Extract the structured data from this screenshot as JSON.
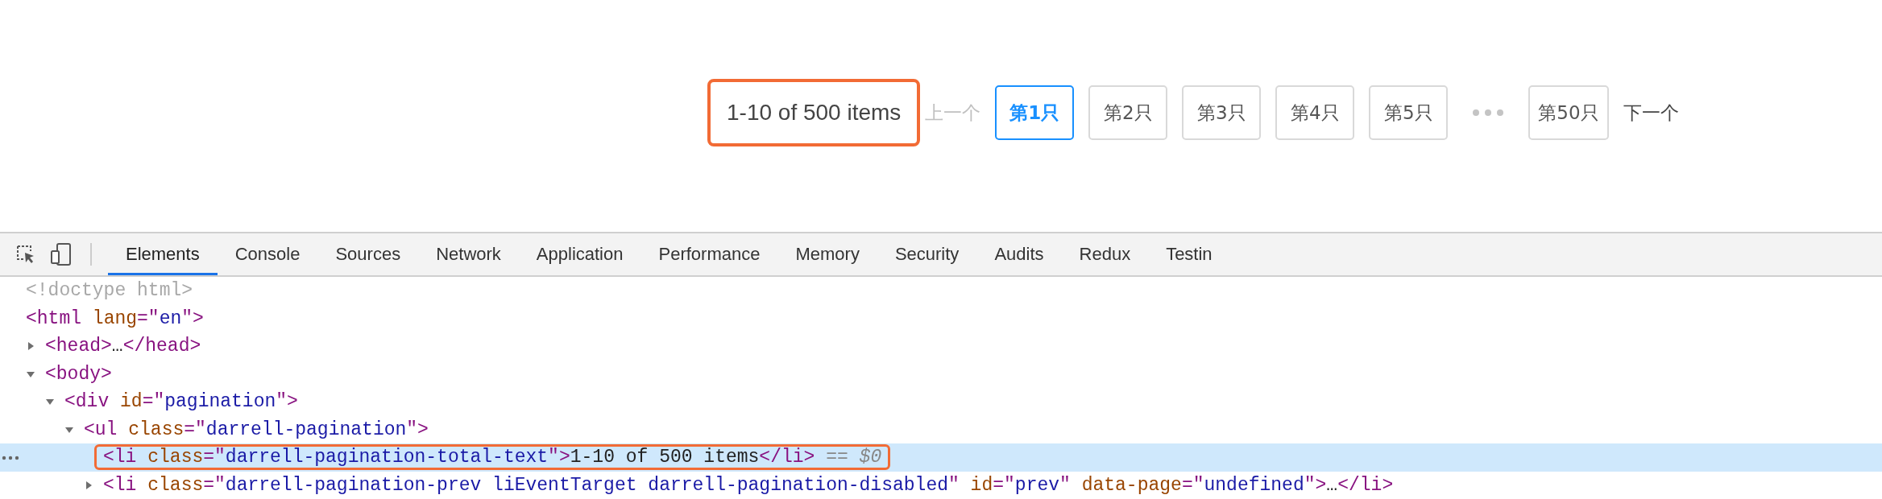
{
  "pagination": {
    "total_text": "1-10 of 500 items",
    "total_annotated": true,
    "items": [
      {
        "kind": "prev",
        "label": "上一个",
        "disabled": true
      },
      {
        "kind": "page",
        "label": "第1只",
        "selected": true
      },
      {
        "kind": "page",
        "label": "第2只",
        "selected": false
      },
      {
        "kind": "page",
        "label": "第3只",
        "selected": false
      },
      {
        "kind": "page",
        "label": "第4只",
        "selected": false
      },
      {
        "kind": "page",
        "label": "第5只",
        "selected": false
      },
      {
        "kind": "ellipsis"
      },
      {
        "kind": "page",
        "label": "第50只",
        "selected": false
      },
      {
        "kind": "next",
        "label": "下一个",
        "disabled": false
      }
    ]
  },
  "devtools": {
    "tabs": [
      {
        "label": "Elements",
        "selected": true
      },
      {
        "label": "Console",
        "selected": false
      },
      {
        "label": "Sources",
        "selected": false
      },
      {
        "label": "Network",
        "selected": false
      },
      {
        "label": "Application",
        "selected": false
      },
      {
        "label": "Performance",
        "selected": false
      },
      {
        "label": "Memory",
        "selected": false
      },
      {
        "label": "Security",
        "selected": false
      },
      {
        "label": "Audits",
        "selected": false
      },
      {
        "label": "Redux",
        "selected": false
      },
      {
        "label": "Testin",
        "selected": false
      }
    ],
    "dom_tree": [
      {
        "tokens": [
          {
            "kind": "doctype",
            "text": "<!doctype html>"
          }
        ]
      },
      {
        "tokens": [
          {
            "kind": "punct",
            "text": "<"
          },
          {
            "kind": "tag",
            "text": "html"
          },
          {
            "kind": "attr",
            "text": "lang"
          },
          {
            "kind": "punct",
            "text": "=\""
          },
          {
            "kind": "value",
            "text": "en"
          },
          {
            "kind": "punct",
            "text": "\">"
          }
        ],
        "children": [
          {
            "expanded": false,
            "tokens": [
              {
                "kind": "punct",
                "text": "<"
              },
              {
                "kind": "tag",
                "text": "head"
              },
              {
                "kind": "punct",
                "text": ">"
              },
              {
                "kind": "text",
                "text": "…"
              },
              {
                "kind": "punct",
                "text": "</"
              },
              {
                "kind": "tag",
                "text": "head"
              },
              {
                "kind": "punct",
                "text": ">"
              }
            ]
          },
          {
            "expanded": true,
            "tokens": [
              {
                "kind": "punct",
                "text": "<"
              },
              {
                "kind": "tag",
                "text": "body"
              },
              {
                "kind": "punct",
                "text": ">"
              }
            ],
            "children": [
              {
                "expanded": true,
                "tokens": [
                  {
                    "kind": "punct",
                    "text": "<"
                  },
                  {
                    "kind": "tag",
                    "text": "div"
                  },
                  {
                    "kind": "attr",
                    "text": "id"
                  },
                  {
                    "kind": "punct",
                    "text": "=\""
                  },
                  {
                    "kind": "value",
                    "text": "pagination"
                  },
                  {
                    "kind": "punct",
                    "text": "\">"
                  }
                ],
                "children": [
                  {
                    "expanded": true,
                    "tokens": [
                      {
                        "kind": "punct",
                        "text": "<"
                      },
                      {
                        "kind": "tag",
                        "text": "ul"
                      },
                      {
                        "kind": "attr",
                        "text": "class"
                      },
                      {
                        "kind": "punct",
                        "text": "=\""
                      },
                      {
                        "kind": "value",
                        "text": "darrell-pagination"
                      },
                      {
                        "kind": "punct",
                        "text": "\">"
                      }
                    ],
                    "children": [
                      {
                        "selected": true,
                        "annotated": true,
                        "tokens": [
                          {
                            "kind": "punct",
                            "text": "<"
                          },
                          {
                            "kind": "tag",
                            "text": "li"
                          },
                          {
                            "kind": "attr",
                            "text": "class"
                          },
                          {
                            "kind": "punct",
                            "text": "=\""
                          },
                          {
                            "kind": "value",
                            "text": "darrell-pagination-total-text"
                          },
                          {
                            "kind": "punct",
                            "text": "\">"
                          },
                          {
                            "kind": "text",
                            "text": "1-10 of 500 items"
                          },
                          {
                            "kind": "punct",
                            "text": "</"
                          },
                          {
                            "kind": "tag",
                            "text": "li"
                          },
                          {
                            "kind": "punct",
                            "text": ">"
                          },
                          {
                            "kind": "hint",
                            "text": " == "
                          },
                          {
                            "kind": "hint-italic",
                            "text": "$0"
                          }
                        ]
                      },
                      {
                        "expanded": false,
                        "tokens": [
                          {
                            "kind": "punct",
                            "text": "<"
                          },
                          {
                            "kind": "tag",
                            "text": "li"
                          },
                          {
                            "kind": "attr",
                            "text": "class"
                          },
                          {
                            "kind": "punct",
                            "text": "=\""
                          },
                          {
                            "kind": "value",
                            "text": "darrell-pagination-prev liEventTarget darrell-pagination-disabled"
                          },
                          {
                            "kind": "punct",
                            "text": "\""
                          },
                          {
                            "kind": "attr",
                            "text": "id"
                          },
                          {
                            "kind": "punct",
                            "text": "=\""
                          },
                          {
                            "kind": "value",
                            "text": "prev"
                          },
                          {
                            "kind": "punct",
                            "text": "\""
                          },
                          {
                            "kind": "attr",
                            "text": "data-page"
                          },
                          {
                            "kind": "punct",
                            "text": "=\""
                          },
                          {
                            "kind": "value",
                            "text": "undefined"
                          },
                          {
                            "kind": "punct",
                            "text": "\">"
                          },
                          {
                            "kind": "text",
                            "text": "…"
                          },
                          {
                            "kind": "punct",
                            "text": "</"
                          },
                          {
                            "kind": "tag",
                            "text": "li"
                          },
                          {
                            "kind": "punct",
                            "text": ">"
                          }
                        ]
                      }
                    ]
                  }
                ]
              }
            ]
          }
        ]
      }
    ]
  }
}
